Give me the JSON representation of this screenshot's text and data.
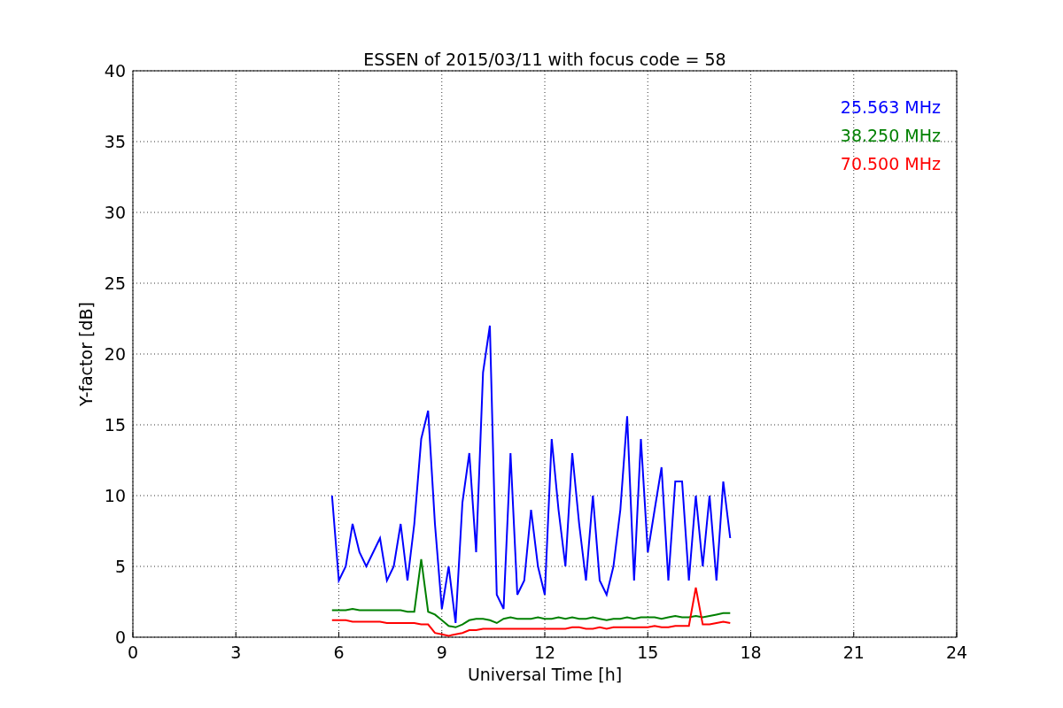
{
  "chart_data": {
    "type": "line",
    "title": "ESSEN of 2015/03/11 with focus code = 58",
    "xlabel": "Universal Time [h]",
    "ylabel": "Y-factor [dB]",
    "x": [
      5.8,
      6.0,
      6.2,
      6.4,
      6.6,
      6.8,
      7.0,
      7.2,
      7.4,
      7.6,
      7.8,
      8.0,
      8.2,
      8.4,
      8.6,
      8.8,
      9.0,
      9.2,
      9.4,
      9.6,
      9.8,
      10.0,
      10.2,
      10.4,
      10.6,
      10.8,
      11.0,
      11.2,
      11.4,
      11.6,
      11.8,
      12.0,
      12.2,
      12.4,
      12.6,
      12.8,
      13.0,
      13.2,
      13.4,
      13.6,
      13.8,
      14.0,
      14.2,
      14.4,
      14.6,
      14.8,
      15.0,
      15.2,
      15.4,
      15.6,
      15.8,
      16.0,
      16.2,
      16.4,
      16.6,
      16.8,
      17.0,
      17.2,
      17.4
    ],
    "series": [
      {
        "name": "25.563 MHz",
        "color": "#0000ff",
        "values": [
          10,
          4,
          5,
          8,
          6,
          5,
          6,
          7,
          4,
          5,
          8,
          4,
          8,
          14,
          16,
          8,
          2,
          5,
          1,
          9.5,
          13,
          6,
          18.7,
          22,
          3,
          2,
          13,
          3,
          4,
          9,
          5,
          3,
          14,
          9,
          5,
          13,
          8,
          4,
          10,
          4,
          3,
          5,
          9,
          15.6,
          4,
          14,
          6,
          9,
          12,
          4,
          11,
          11,
          4,
          10,
          5,
          10,
          4,
          11,
          7
        ]
      },
      {
        "name": "38.250 MHz",
        "color": "#008000",
        "values": [
          1.9,
          1.9,
          1.9,
          2.0,
          1.9,
          1.9,
          1.9,
          1.9,
          1.9,
          1.9,
          1.9,
          1.8,
          1.8,
          5.5,
          1.8,
          1.6,
          1.2,
          0.8,
          0.7,
          0.9,
          1.2,
          1.3,
          1.3,
          1.2,
          1.0,
          1.3,
          1.4,
          1.3,
          1.3,
          1.3,
          1.4,
          1.3,
          1.3,
          1.4,
          1.3,
          1.4,
          1.3,
          1.3,
          1.4,
          1.3,
          1.2,
          1.3,
          1.3,
          1.4,
          1.3,
          1.4,
          1.4,
          1.4,
          1.3,
          1.4,
          1.5,
          1.4,
          1.4,
          1.5,
          1.4,
          1.5,
          1.6,
          1.7,
          1.7
        ]
      },
      {
        "name": "70.500 MHz",
        "color": "#ff0000",
        "values": [
          1.2,
          1.2,
          1.2,
          1.1,
          1.1,
          1.1,
          1.1,
          1.1,
          1.0,
          1.0,
          1.0,
          1.0,
          1.0,
          0.9,
          0.9,
          0.3,
          0.2,
          0.1,
          0.2,
          0.3,
          0.5,
          0.5,
          0.6,
          0.6,
          0.6,
          0.6,
          0.6,
          0.6,
          0.6,
          0.6,
          0.6,
          0.6,
          0.6,
          0.6,
          0.6,
          0.7,
          0.7,
          0.6,
          0.6,
          0.7,
          0.6,
          0.7,
          0.7,
          0.7,
          0.7,
          0.7,
          0.7,
          0.8,
          0.7,
          0.7,
          0.8,
          0.8,
          0.8,
          3.5,
          0.9,
          0.9,
          1.0,
          1.1,
          1.0
        ]
      }
    ],
    "xlim": [
      0,
      24
    ],
    "ylim": [
      0,
      40
    ],
    "xticks": [
      0,
      3,
      6,
      9,
      12,
      15,
      18,
      21,
      24
    ],
    "yticks": [
      0,
      5,
      10,
      15,
      20,
      25,
      30,
      35,
      40
    ],
    "grid": true
  }
}
